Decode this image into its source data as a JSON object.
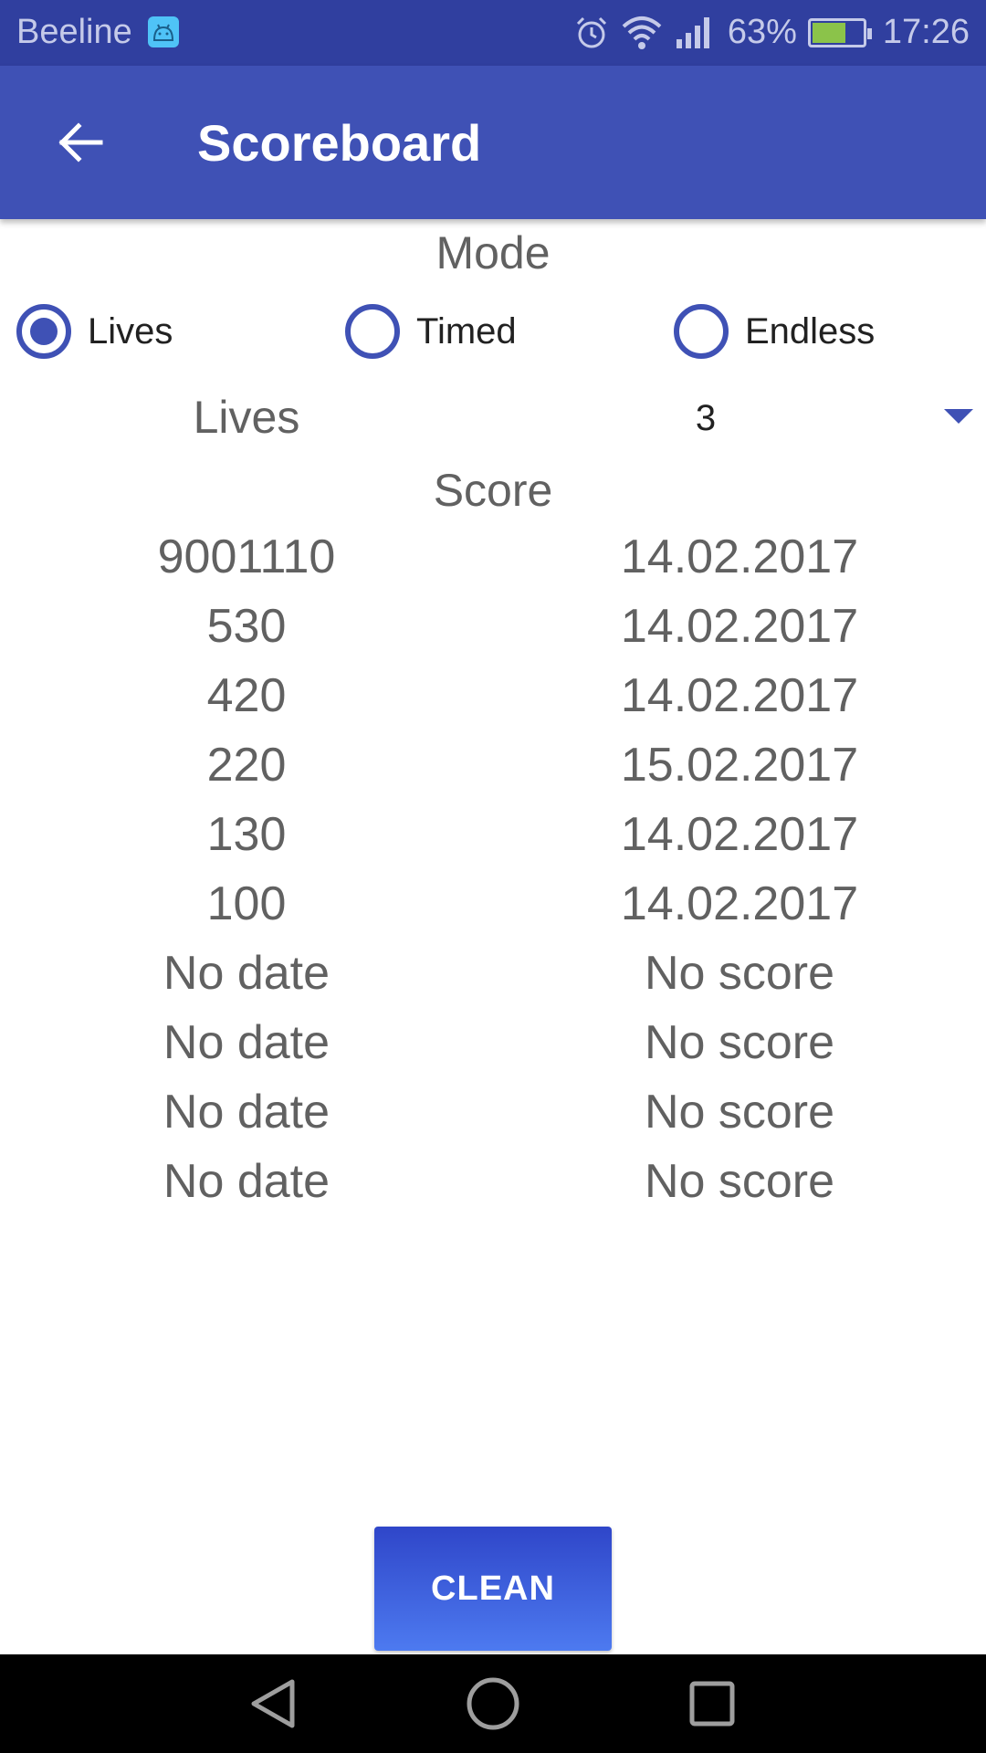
{
  "status_bar": {
    "carrier": "Beeline",
    "battery_percent": "63%",
    "time": "17:26",
    "icons": [
      "android-debug-icon",
      "alarm-icon",
      "wifi-icon",
      "signal-icon",
      "battery-icon"
    ],
    "battery_level": 0.63
  },
  "app_bar": {
    "title": "Scoreboard",
    "back_icon": "arrow-left-icon"
  },
  "mode": {
    "label": "Mode",
    "options": [
      {
        "label": "Lives",
        "checked": true
      },
      {
        "label": "Timed",
        "checked": false
      },
      {
        "label": "Endless",
        "checked": false
      }
    ]
  },
  "lives": {
    "label": "Lives",
    "selected": "3"
  },
  "score": {
    "label": "Score",
    "rows": [
      {
        "c1": "9001110",
        "c2": "14.02.2017"
      },
      {
        "c1": "530",
        "c2": "14.02.2017"
      },
      {
        "c1": "420",
        "c2": "14.02.2017"
      },
      {
        "c1": "220",
        "c2": "15.02.2017"
      },
      {
        "c1": "130",
        "c2": "14.02.2017"
      },
      {
        "c1": "100",
        "c2": "14.02.2017"
      },
      {
        "c1": "No date",
        "c2": "No score"
      },
      {
        "c1": "No date",
        "c2": "No score"
      },
      {
        "c1": "No date",
        "c2": "No score"
      },
      {
        "c1": "No date",
        "c2": "No score"
      }
    ]
  },
  "clean_button": "CLEAN",
  "colors": {
    "primary": "#3f51b5",
    "primary_dark": "#303f9f",
    "button_gradient_top": "#2f46c9",
    "button_gradient_bottom": "#4d7af0"
  }
}
